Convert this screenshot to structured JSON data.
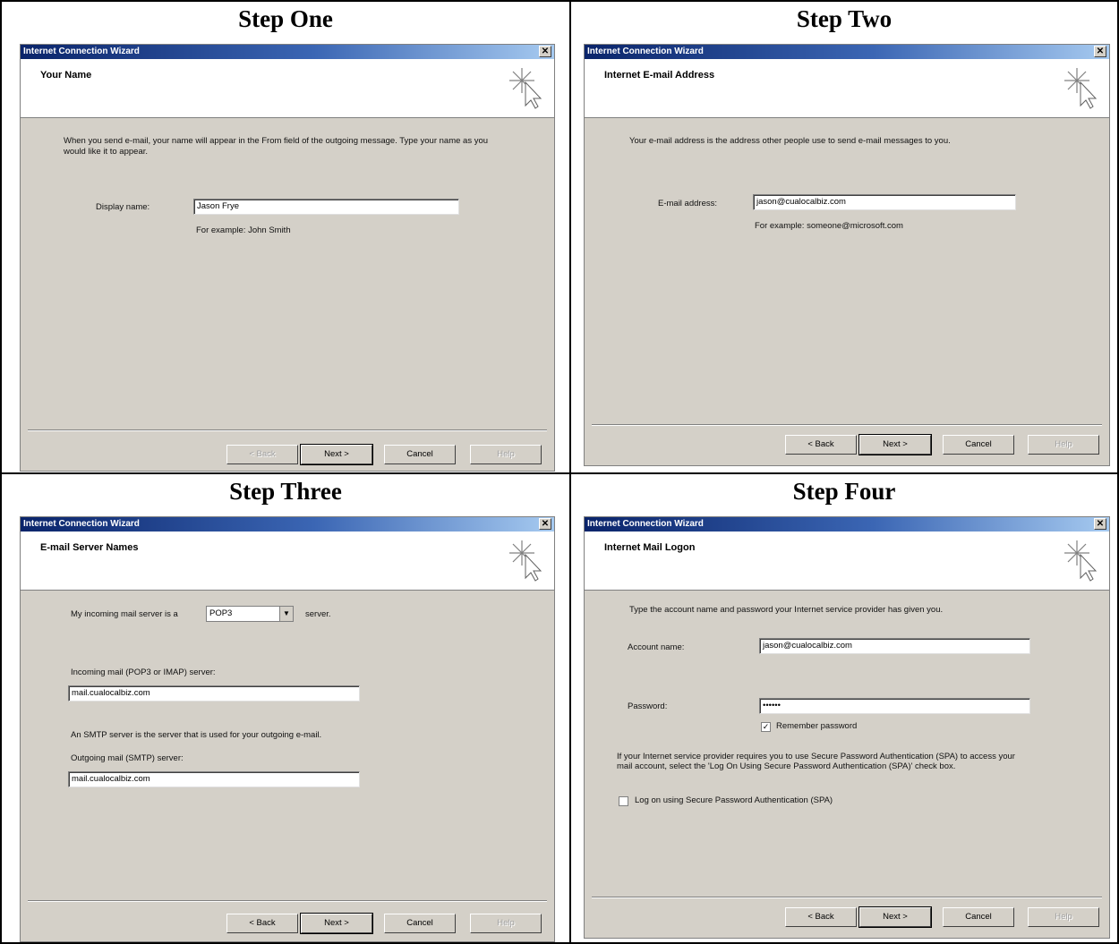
{
  "window_title": "Internet Connection Wizard",
  "close_glyph": "✕",
  "step_one": {
    "label": "Step One",
    "header": "Your Name",
    "intro": "When you send e-mail, your name will appear in the From field of the outgoing message. Type your name as you would like it to appear.",
    "field_label": "Display name:",
    "field_value": "Jason Frye",
    "hint": "For example: John Smith"
  },
  "step_two": {
    "label": "Step Two",
    "header": "Internet E-mail Address",
    "intro": "Your e-mail address is the address other people use to send e-mail messages to you.",
    "field_label": "E-mail address:",
    "field_value": "jason@cualocalbiz.com",
    "hint": "For example: someone@microsoft.com"
  },
  "step_three": {
    "label": "Step Three",
    "header": "E-mail Server Names",
    "server_type_prefix": "My incoming mail server is a",
    "server_type_value": "POP3",
    "server_type_suffix": "server.",
    "incoming_label": "Incoming mail (POP3 or IMAP) server:",
    "incoming_value": "mail.cualocalbiz.com",
    "smtp_note": "An SMTP server is the server that is used for your outgoing e-mail.",
    "outgoing_label": "Outgoing mail (SMTP) server:",
    "outgoing_value": "mail.cualocalbiz.com"
  },
  "step_four": {
    "label": "Step Four",
    "header": "Internet Mail Logon",
    "intro": "Type the account name and password your Internet service provider has given you.",
    "account_label": "Account name:",
    "account_value": "jason@cualocalbiz.com",
    "password_label": "Password:",
    "password_value": "••••••",
    "remember_label": "Remember password",
    "remember_checked": true,
    "spa_note": "If your Internet service provider requires you to use Secure Password Authentication (SPA) to access your mail account, select the 'Log On Using Secure Password Authentication (SPA)' check box.",
    "spa_label": "Log on using Secure Password Authentication (SPA)",
    "spa_checked": false
  },
  "buttons": {
    "back": "< Back",
    "next": "Next >",
    "cancel": "Cancel",
    "help": "Help"
  },
  "check_glyph": "✓"
}
